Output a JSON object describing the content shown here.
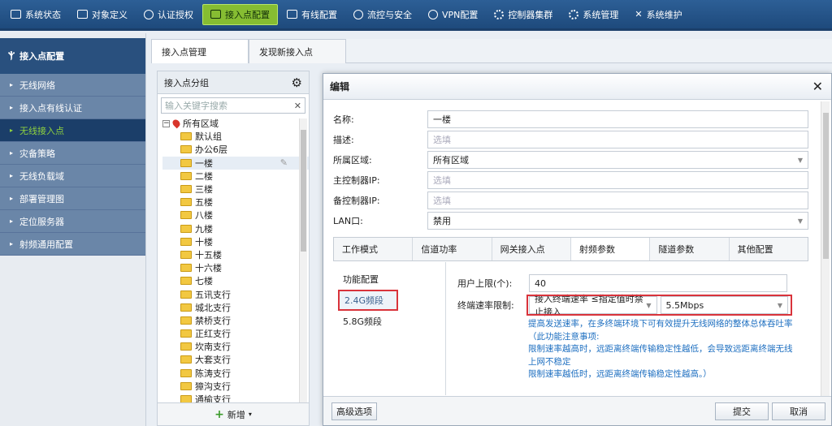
{
  "topnav": [
    {
      "label": "系统状态",
      "icon": "monitor-icon"
    },
    {
      "label": "对象定义",
      "icon": "cube-icon"
    },
    {
      "label": "认证授权",
      "icon": "user-icon"
    },
    {
      "label": "接入点配置",
      "icon": "ap-signal-icon",
      "active": true
    },
    {
      "label": "有线配置",
      "icon": "network-icon"
    },
    {
      "label": "流控与安全",
      "icon": "globe-icon"
    },
    {
      "label": "VPN配置",
      "icon": "vpn-icon"
    },
    {
      "label": "控制器集群",
      "icon": "gear-icon"
    },
    {
      "label": "系统管理",
      "icon": "gear-icon"
    },
    {
      "label": "系统维护",
      "icon": "tools-icon"
    }
  ],
  "sidebar": {
    "header": "接入点配置",
    "items": [
      {
        "label": "无线网络"
      },
      {
        "label": "接入点有线认证"
      },
      {
        "label": "无线接入点",
        "active": true
      },
      {
        "label": "灾备策略"
      },
      {
        "label": "无线负载域"
      },
      {
        "label": "部署管理图"
      },
      {
        "label": "定位服务器"
      },
      {
        "label": "射频通用配置"
      }
    ]
  },
  "tabs": [
    "接入点管理",
    "发现新接入点"
  ],
  "group_panel": {
    "title": "接入点分组",
    "search_placeholder": "输入关键字搜索",
    "root": "所有区域",
    "groups": [
      "默认组",
      "办公6层",
      "一楼",
      "二楼",
      "三楼",
      "五楼",
      "八楼",
      "九楼",
      "十楼",
      "十五楼",
      "十六楼",
      "七楼",
      "五讯支行",
      "城北支行",
      "禁桥支行",
      "正红支行",
      "坎南支行",
      "大套支行",
      "陈涛支行",
      "獐沟支行",
      "通榆支行"
    ],
    "selected": "一楼",
    "add_label": "新增"
  },
  "modal": {
    "title": "编辑",
    "fields": {
      "name_label": "名称:",
      "name_value": "一楼",
      "desc_label": "描述:",
      "desc_placeholder": "选填",
      "area_label": "所属区域:",
      "area_value": "所有区域",
      "main_ip_label": "主控制器IP:",
      "main_ip_placeholder": "选填",
      "backup_ip_label": "备控制器IP:",
      "backup_ip_placeholder": "选填",
      "lan_label": "LAN口:",
      "lan_value": "禁用"
    },
    "subtabs": [
      "工作模式",
      "信道功率",
      "网关接入点",
      "射频参数",
      "隧道参数",
      "其他配置"
    ],
    "active_subtab": "射频参数",
    "bands": {
      "header": "功能配置",
      "items": [
        "2.4G频段",
        "5.8G频段"
      ],
      "selected": "2.4G频段"
    },
    "user_limit_label": "用户上限(个):",
    "user_limit_value": "40",
    "rate_limit_label": "终端速率限制:",
    "rate_limit_mode": "接入终端速率 ≤指定值时禁止接入",
    "rate_limit_value": "5.5Mbps",
    "notes": [
      "提高发送速率，在多终端环境下可有效提升无线网络的整体总体吞吐率",
      "（此功能注意事项:",
      "限制速率越高时，远距离终端传输稳定性越低，会导致远距离终端无线上网不稳定",
      "限制速率越低时，远距离终端传输稳定性越高。）"
    ],
    "advanced_label": "高级选项",
    "submit_label": "提交",
    "cancel_label": "取消"
  }
}
